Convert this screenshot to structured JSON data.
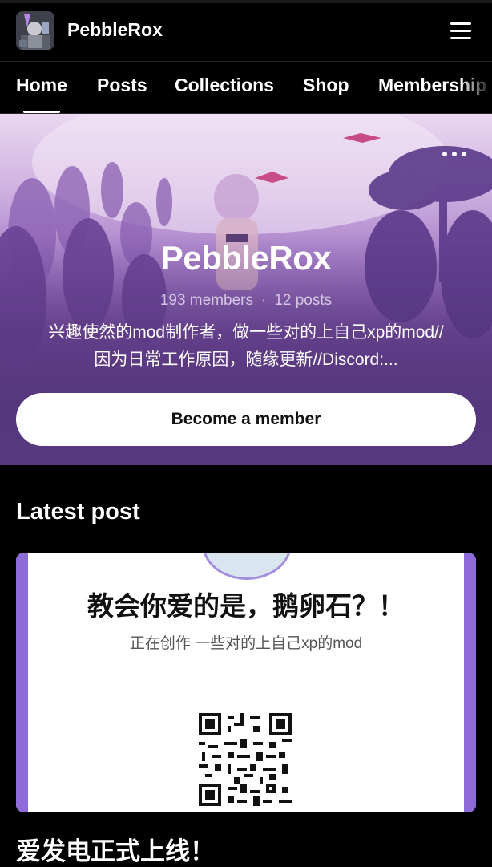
{
  "header": {
    "creator_name": "PebbleRox",
    "avatar_icon": "creator-avatar",
    "menu_icon": "hamburger-menu-icon"
  },
  "nav": {
    "tabs": [
      {
        "label": "Home",
        "active": true
      },
      {
        "label": "Posts"
      },
      {
        "label": "Collections"
      },
      {
        "label": "Shop"
      },
      {
        "label": "Membership"
      }
    ]
  },
  "hero": {
    "name": "PebbleRox",
    "members": "193 members",
    "separator": "·",
    "posts": "12 posts",
    "about_line1": "兴趣使然的mod制作者，做一些对的上自己xp的mod//",
    "about_line2": "因为日常工作原因，随缘更新//Discord:...",
    "cta": "Become a member",
    "more_icon": "more-dots-icon"
  },
  "latest": {
    "section_title": "Latest post",
    "image_headline": "教会你爱的是，鹅卵石？！",
    "image_subtitle": "正在创作 一些对的上自己xp的mod",
    "post_title": "爱发电正式上线！"
  },
  "colors": {
    "background": "#000000",
    "hero_purple": "#5b3a82",
    "card_accent": "#8e6bd9",
    "button_bg": "#ffffff"
  }
}
